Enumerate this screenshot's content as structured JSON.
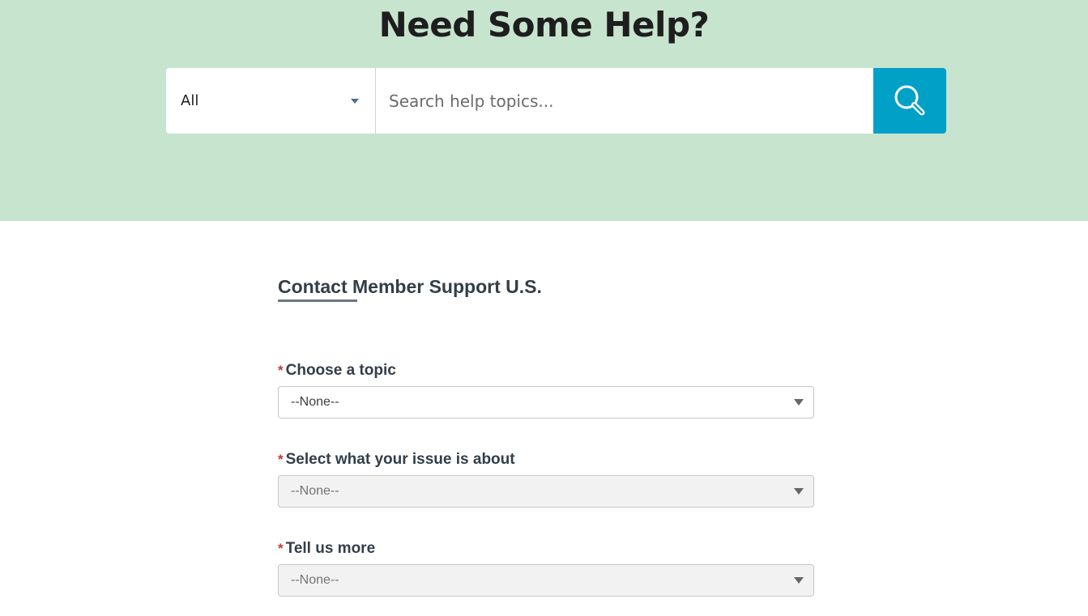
{
  "hero": {
    "title": "Need Some Help?",
    "search": {
      "scope_value": "All",
      "placeholder": "Search help topics...",
      "button_icon": "magnifier-icon"
    }
  },
  "form": {
    "title": "Contact Member Support U.S.",
    "fields": [
      {
        "label": "Choose a topic",
        "required_mark": "*",
        "value": "--None--",
        "disabled": false
      },
      {
        "label": "Select what your issue is about",
        "required_mark": "*",
        "value": "--None--",
        "disabled": true
      },
      {
        "label": "Tell us more",
        "required_mark": "*",
        "value": "--None--",
        "disabled": true
      }
    ]
  },
  "colors": {
    "hero_bg": "#c7e4cf",
    "search_button": "#00a0c7",
    "required": "#c23934"
  }
}
